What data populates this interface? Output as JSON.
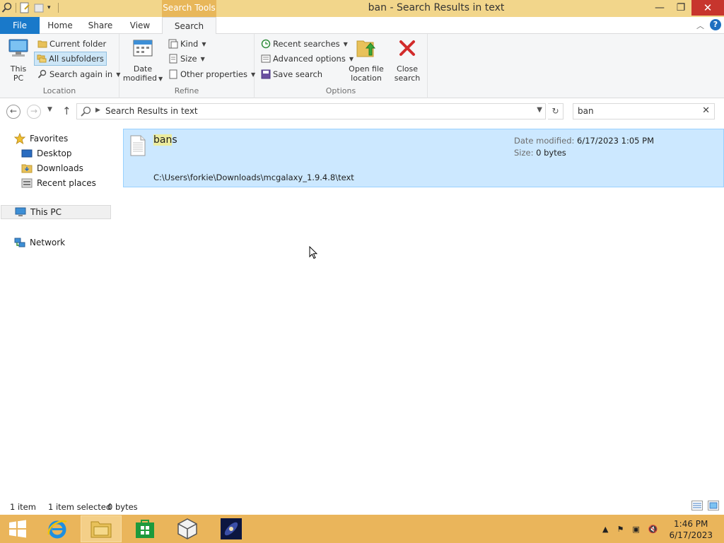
{
  "window": {
    "title": "ban - Search Results in text",
    "context_tab_label": "Search Tools"
  },
  "ribbon_tabs": [
    "File",
    "Home",
    "Share",
    "View",
    "Search"
  ],
  "ribbon": {
    "location": {
      "label": "Location",
      "this_pc": "This\nPC",
      "current_folder": "Current folder",
      "all_subfolders": "All subfolders",
      "search_again_in": "Search again in"
    },
    "refine": {
      "label": "Refine",
      "date_modified": "Date\nmodified",
      "kind": "Kind",
      "size": "Size",
      "other_properties": "Other properties"
    },
    "options": {
      "label": "Options",
      "recent_searches": "Recent searches",
      "advanced_options": "Advanced options",
      "save_search": "Save search",
      "open_file_location": "Open file\nlocation",
      "close_search": "Close\nsearch"
    }
  },
  "address": {
    "path": "Search Results in text",
    "search_value": "ban"
  },
  "nav_pane": {
    "favorites": "Favorites",
    "desktop": "Desktop",
    "downloads": "Downloads",
    "recent_places": "Recent places",
    "this_pc": "This PC",
    "network": "Network"
  },
  "results": [
    {
      "name_highlight": "ban",
      "name_rest": "s",
      "path": "C:\\Users\\forkie\\Downloads\\mcgalaxy_1.9.4.8\\text",
      "date_label": "Date modified:",
      "date_value": "6/17/2023 1:05 PM",
      "size_label": "Size:",
      "size_value": "0 bytes"
    }
  ],
  "status": {
    "item_count": "1 item",
    "selection": "1 item selected",
    "selection_size": "0 bytes"
  },
  "taskbar": {
    "time": "1:46 PM",
    "date": "6/17/2023"
  },
  "colors": {
    "accent": "#1979ca",
    "titlebar": "#f2d68b",
    "taskbar": "#eab55b",
    "selection": "#cce8ff"
  }
}
